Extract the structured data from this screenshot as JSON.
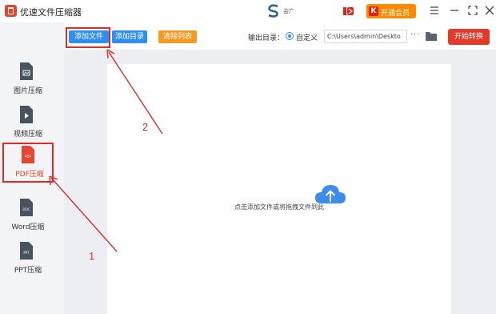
{
  "app": {
    "title": "优速文件压缩器",
    "user_name": "会广",
    "vip_label": "开通会员",
    "vip_icon_text": "K"
  },
  "sidebar": {
    "items": [
      {
        "label": "图片压缩",
        "icon": "image-file-icon",
        "doc_text": ""
      },
      {
        "label": "视频压缩",
        "icon": "video-file-icon",
        "doc_text": ""
      },
      {
        "label": "PDF压缩",
        "icon": "pdf-file-icon",
        "doc_text": "PDF",
        "active": true
      },
      {
        "label": "Word压缩",
        "icon": "doc-file-icon",
        "doc_text": "DOC"
      },
      {
        "label": "PPT压缩",
        "icon": "ppt-file-icon",
        "doc_text": "PPT"
      }
    ]
  },
  "toolbar": {
    "add_file": "添加文件",
    "add_dir": "添加目录",
    "clear_list": "清除列表",
    "output_label": "输出目录：",
    "custom_label": "自定义",
    "output_path": "C:\\Users\\admin\\Deskto",
    "more": "···",
    "start": "开始转换"
  },
  "main": {
    "drop_hint": "点击添加文件或将拖拽文件到此"
  },
  "annotations": {
    "step_1": "1",
    "step_2": "2"
  },
  "colors": {
    "accent_blue": "#2f8ef0",
    "accent_orange": "#f59a23",
    "accent_red": "#e23b2a",
    "annotation_red": "#e02a2a",
    "pdf_red": "#e5452e",
    "sidebar_bg": "#f3f4f6",
    "workspace_bg": "#eceef1"
  }
}
